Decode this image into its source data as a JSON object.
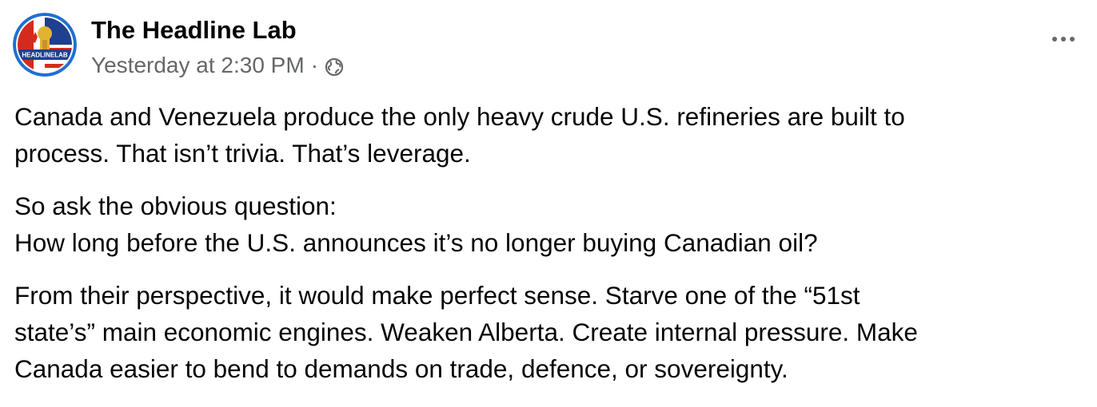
{
  "post": {
    "page_name": "The Headline Lab",
    "timestamp": "Yesterday at 2:30 PM",
    "separator": "·",
    "audience_icon": "globe-icon",
    "more_icon": "more-options-icon",
    "avatar": {
      "logo_text": "HEADLINELAB",
      "colors": {
        "ring": "#1f6fd1",
        "flag_red": "#d52b1e",
        "flag_blue": "#1f3f8f",
        "gold": "#e2b331"
      }
    },
    "paragraphs": [
      "Canada and Venezuela produce the only heavy crude U.S. refineries are built to\nprocess. That isn’t trivia. That’s leverage.",
      "So ask the obvious question:\nHow long before the U.S. announces it’s no longer buying Canadian oil?",
      "From their perspective, it would make perfect sense. Starve one of the “51st\nstate’s” main economic engines. Weaken Alberta. Create internal pressure. Make\nCanada easier to bend to demands on trade, defence, or sovereignty."
    ]
  }
}
